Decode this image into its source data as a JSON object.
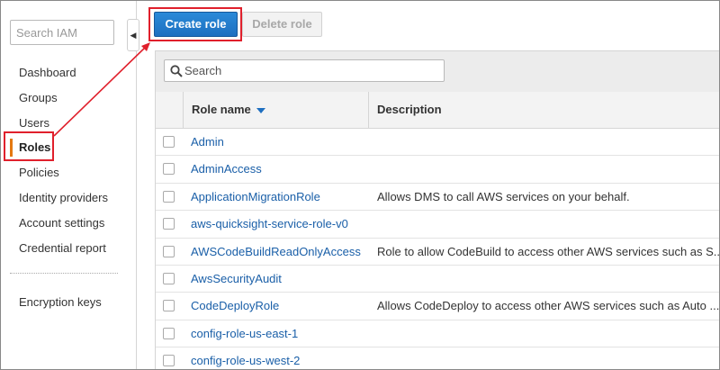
{
  "sidebar": {
    "search_placeholder": "Search IAM",
    "items": [
      {
        "label": "Dashboard"
      },
      {
        "label": "Groups"
      },
      {
        "label": "Users"
      },
      {
        "label": "Roles"
      },
      {
        "label": "Policies"
      },
      {
        "label": "Identity providers"
      },
      {
        "label": "Account settings"
      },
      {
        "label": "Credential report"
      }
    ],
    "active_index": 3,
    "secondary": {
      "label": "Encryption keys"
    }
  },
  "toolbar": {
    "create_label": "Create role",
    "delete_label": "Delete role"
  },
  "table": {
    "search_placeholder": "Search",
    "columns": {
      "name": "Role name",
      "description": "Description"
    },
    "rows": [
      {
        "name": "Admin",
        "description": ""
      },
      {
        "name": "AdminAccess",
        "description": ""
      },
      {
        "name": "ApplicationMigrationRole",
        "description": "Allows DMS to call AWS services on your behalf."
      },
      {
        "name": "aws-quicksight-service-role-v0",
        "description": ""
      },
      {
        "name": "AWSCodeBuildReadOnlyAccess",
        "description": "Role to allow CodeBuild to access other AWS services such as S..."
      },
      {
        "name": "AwsSecurityAudit",
        "description": ""
      },
      {
        "name": "CodeDeployRole",
        "description": "Allows CodeDeploy to access other AWS services such as Auto ..."
      },
      {
        "name": "config-role-us-east-1",
        "description": ""
      },
      {
        "name": "config-role-us-west-2",
        "description": ""
      }
    ]
  },
  "colors": {
    "accent_blue": "#1e6fc0",
    "link_blue": "#1a5fa8",
    "active_marker": "#e47911",
    "highlight_red": "#e0202c"
  }
}
